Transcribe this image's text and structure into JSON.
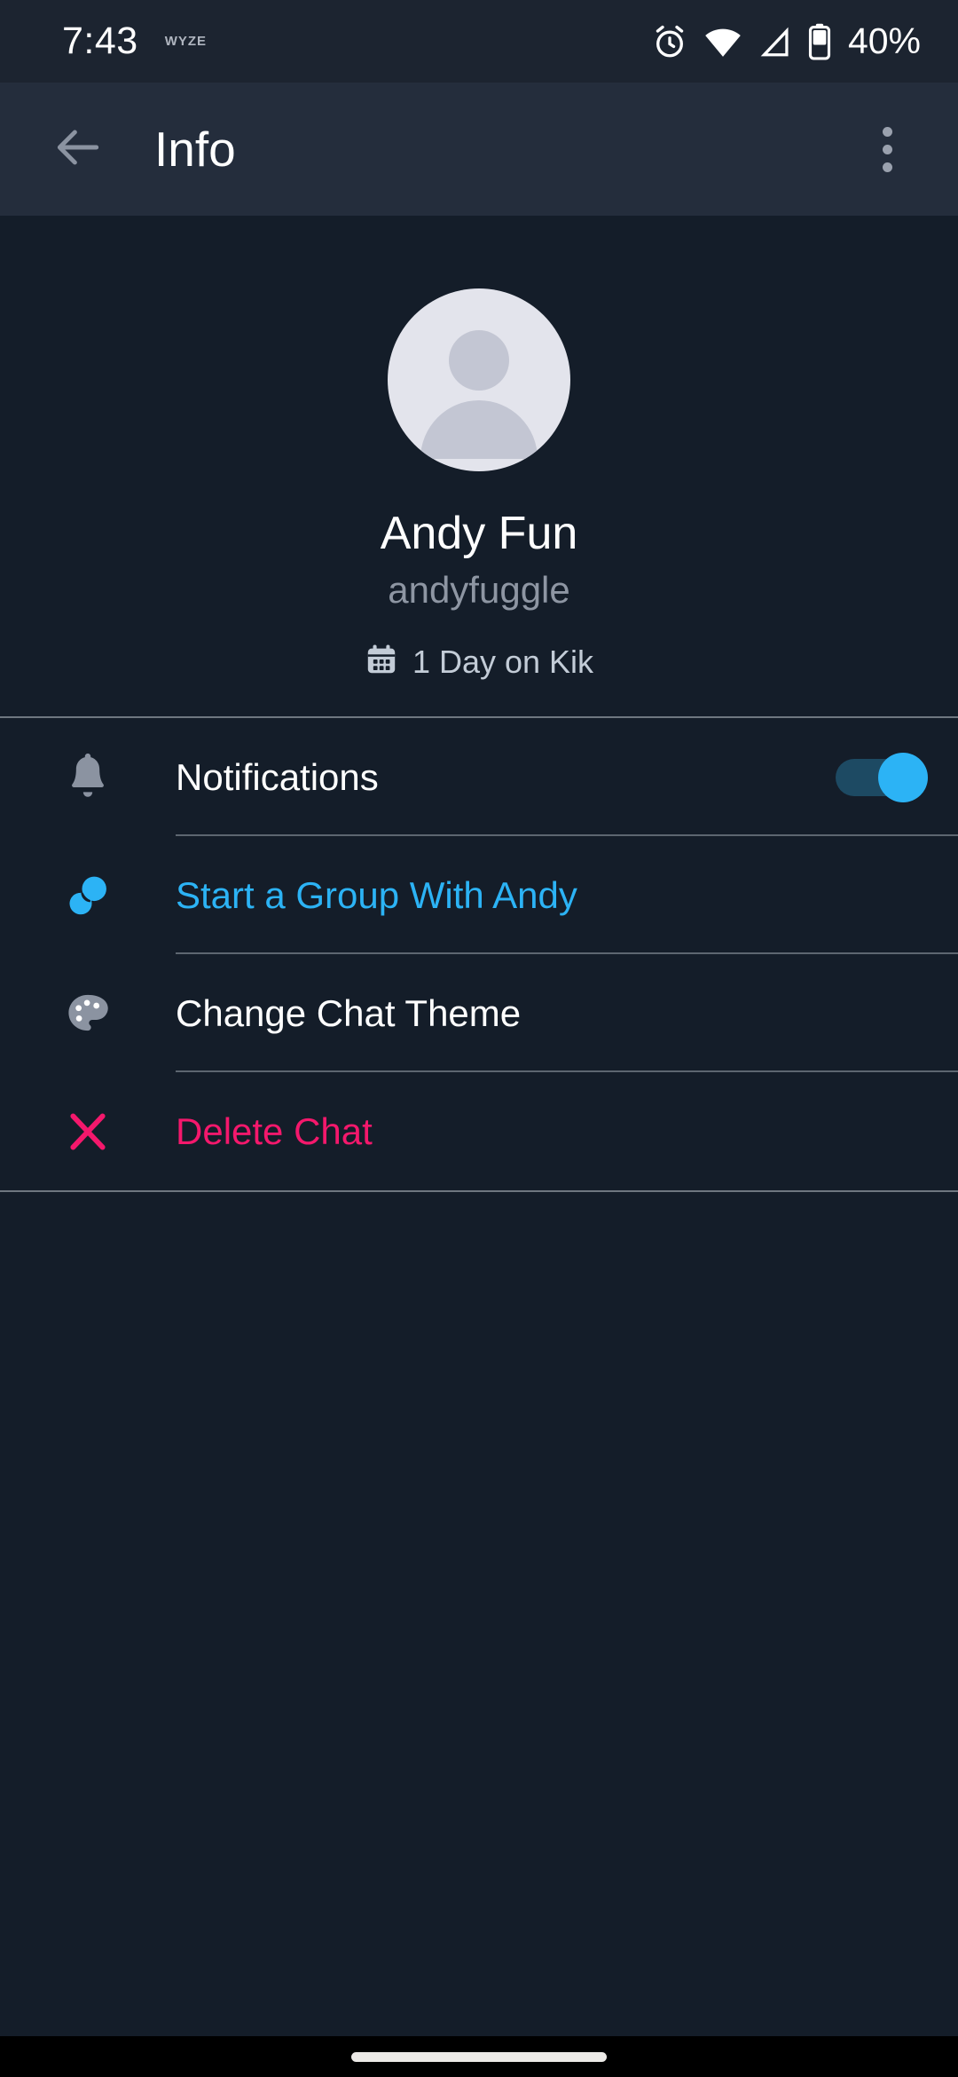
{
  "status_bar": {
    "time": "7:43",
    "carrier_or_app": "WYZE",
    "battery_percent": "40%",
    "icons": [
      "alarm-icon",
      "wifi-icon",
      "cellular-signal-icon",
      "battery-icon"
    ]
  },
  "app_bar": {
    "back_icon": "back-arrow-icon",
    "title": "Info",
    "overflow_icon": "overflow-menu-icon"
  },
  "profile": {
    "avatar_icon": "default-person-avatar",
    "name": "Andy Fun",
    "username": "andyfuggle",
    "tenure_icon": "calendar-icon",
    "tenure_text": "1 Day on Kik"
  },
  "list": {
    "rows": [
      {
        "id": "notifications",
        "icon": "bell-icon",
        "label": "Notifications",
        "style": "white",
        "control": "toggle",
        "toggle_on": true
      },
      {
        "id": "start-group",
        "icon": "group-icon",
        "label": "Start a Group With Andy",
        "style": "blue",
        "control": "none"
      },
      {
        "id": "change-theme",
        "icon": "palette-icon",
        "label": "Change Chat Theme",
        "style": "white",
        "control": "none"
      },
      {
        "id": "delete-chat",
        "icon": "close-x-icon",
        "label": "Delete Chat",
        "style": "pink",
        "control": "none"
      }
    ]
  },
  "nav_bar": {
    "gesture_pill": "home-gesture-pill"
  },
  "colors": {
    "background": "#141d29",
    "status_bar_bg": "#1c2430",
    "app_bar_bg": "#242d3c",
    "accent_blue": "#2cb3f5",
    "danger_pink": "#f4186c",
    "icon_gray": "#8b93a1",
    "divider": "#5d6670",
    "text_primary": "#ffffff",
    "text_secondary": "#8e96a3"
  }
}
